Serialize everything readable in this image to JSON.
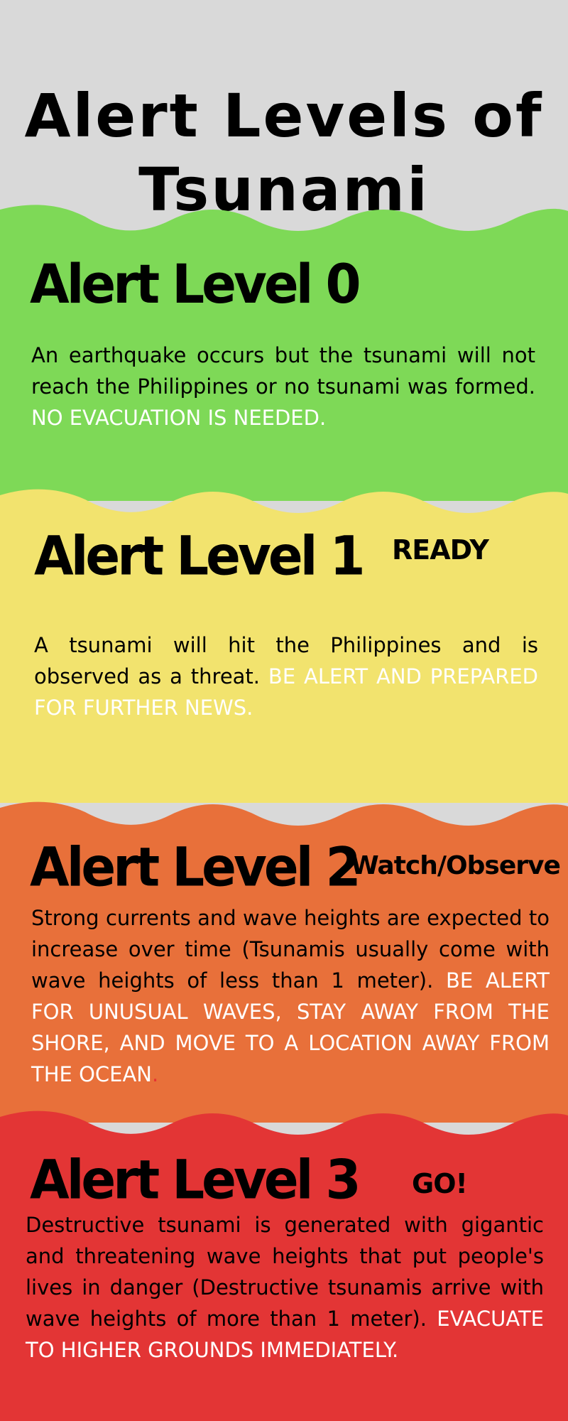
{
  "title": "Alert Levels of Tsunami",
  "colors": {
    "background": "#d9d9d9",
    "level0": "#7ed957",
    "level1": "#f2e36e",
    "level2": "#e8703a",
    "level3": "#e33535"
  },
  "levels": [
    {
      "heading": "Alert Level 0",
      "tag": "",
      "text": "An earthquake occurs but the tsunami will not reach the Philippines or no tsunami was formed. ",
      "highlight": "NO EVACUATION IS NEEDED."
    },
    {
      "heading": "Alert Level 1",
      "tag": "READY",
      "text": "A tsunami will hit the Philippines and is observed as a threat. ",
      "highlight": "BE ALERT AND PREPARED FOR FURTHER NEWS."
    },
    {
      "heading": "Alert Level 2",
      "tag": "Watch/Observe",
      "text": "Strong currents and wave heights are expected to increase over time (Tsunamis usually come with wave heights of less than 1 meter). ",
      "highlight": "BE ALERT FOR UNUSUAL WAVES, STAY AWAY FROM THE SHORE, AND MOVE TO A LOCATION AWAY FROM THE OCEAN",
      "trailing": "."
    },
    {
      "heading": "Alert Level 3",
      "tag": "GO!",
      "text": "Destructive tsunami is generated with gigantic and threatening wave heights that put people's lives in danger (Destructive tsunamis arrive with wave heights of more than 1 meter). ",
      "highlight": "EVACUATE TO HIGHER GROUNDS IMMEDIATELY."
    }
  ]
}
